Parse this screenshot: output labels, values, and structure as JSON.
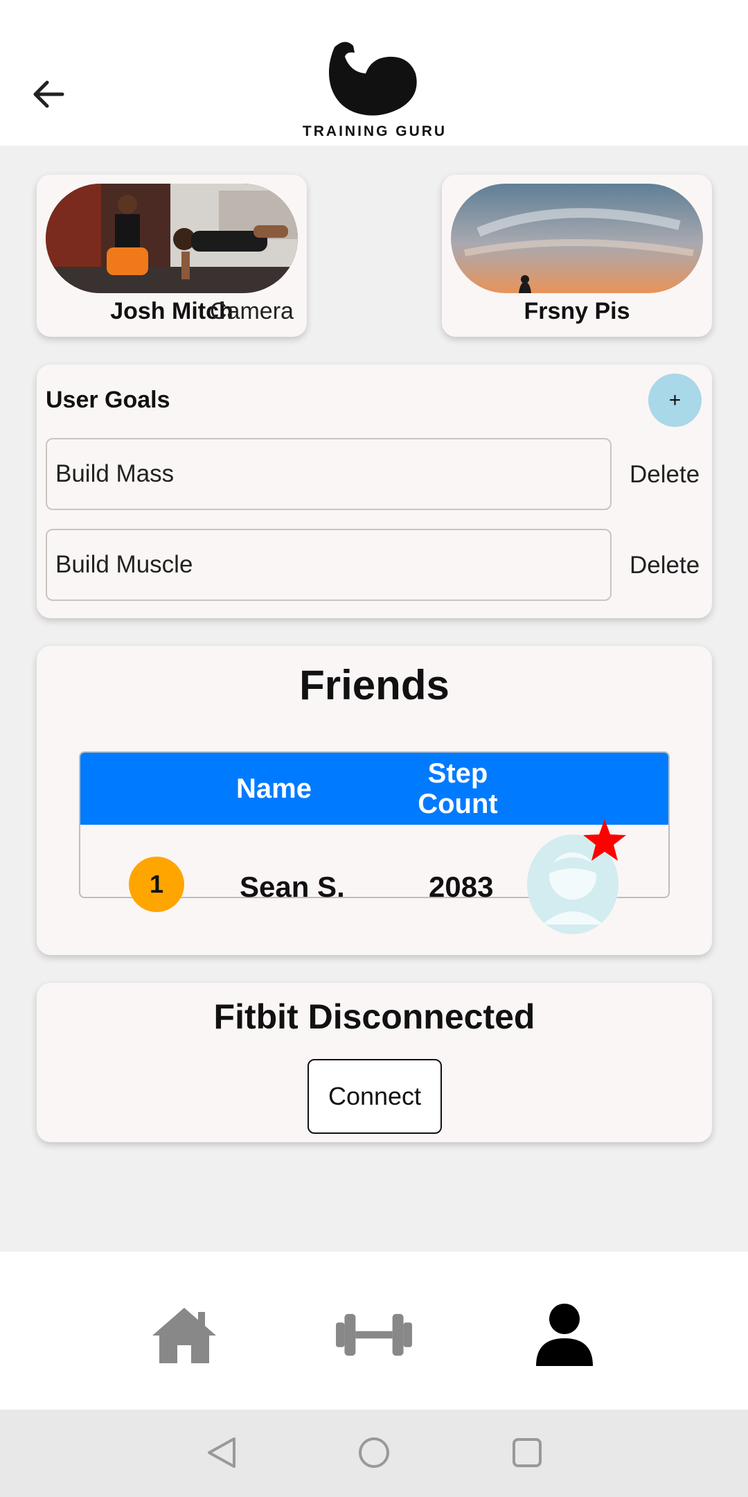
{
  "header": {
    "logo_text": "TRAINING GURU"
  },
  "profiles": [
    {
      "name": "Josh Mitch",
      "camera_label": "Camera"
    },
    {
      "name": "Frsny Pis"
    }
  ],
  "goals": {
    "title": "User Goals",
    "add_label": "+",
    "items": [
      {
        "value": "Build Mass",
        "delete_label": "Delete"
      },
      {
        "value": "Build Muscle",
        "delete_label": "Delete"
      }
    ]
  },
  "friends": {
    "title": "Friends",
    "columns": [
      "Name",
      "Step Count"
    ],
    "rows": [
      {
        "rank": "1",
        "name": "Sean S.",
        "steps": "2083"
      }
    ]
  },
  "fitbit": {
    "status": "Fitbit Disconnected",
    "connect_label": "Connect"
  },
  "bottom_nav": {
    "items": [
      "home-icon",
      "dumbbell-icon",
      "profile-icon"
    ],
    "active": "profile-icon"
  },
  "colors": {
    "table_header": "#007bff",
    "rank_badge": "#ffa500",
    "add_button": "#a9d8e8",
    "star": "#ff0000"
  }
}
